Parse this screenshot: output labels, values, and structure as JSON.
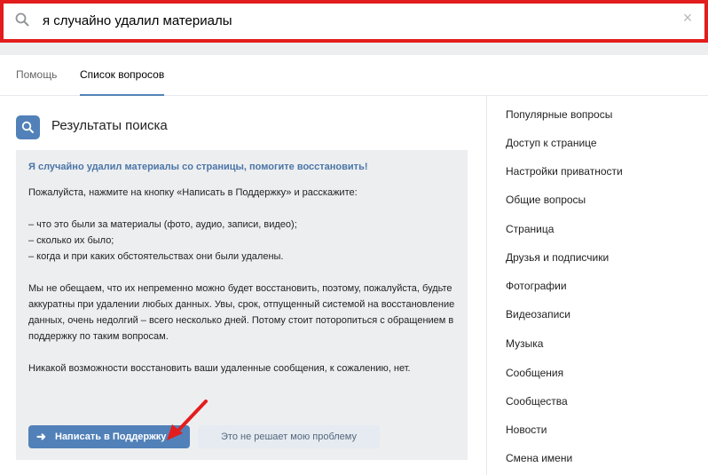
{
  "search": {
    "value": "я случайно удалил материалы",
    "icon": "search-icon",
    "clear_glyph": "×"
  },
  "tabs": [
    {
      "label": "Помощь",
      "active": false
    },
    {
      "label": "Список вопросов",
      "active": true
    }
  ],
  "results": {
    "title": "Результаты поиска",
    "question": "Я случайно удалил материалы со страницы, помогите восстановить!",
    "paragraphs": [
      "Пожалуйста, нажмите на кнопку «Написать в Поддержку» и расскажите:",
      "– что это были за материалы (фото, аудио, записи, видео);\n– сколько их было;\n– когда и при каких обстоятельствах они были удалены.",
      "Мы не обещаем, что их непременно можно будет восстановить, поэтому, пожалуйста, будьте аккуратны при удалении любых данных. Увы, срок, отпущенный системой на восстановление данных, очень недолгий – всего несколько дней. Потому стоит поторопиться с обращением в поддержку по таким вопросам.",
      "Никакой возможности восстановить ваши удаленные сообщения, к сожалению, нет."
    ],
    "primary_button": "Написать в Поддержку",
    "primary_arrow": "➜",
    "secondary_button": "Это не решает мою проблему"
  },
  "sidebar": {
    "items": [
      "Популярные вопросы",
      "Доступ к странице",
      "Настройки приватности",
      "Общие вопросы",
      "Страница",
      "Друзья и подписчики",
      "Фотографии",
      "Видеозаписи",
      "Музыка",
      "Сообщения",
      "Сообщества",
      "Новости",
      "Смена имени"
    ]
  },
  "colors": {
    "highlight_border": "#e31d1d",
    "accent": "#5181b8",
    "link": "#4a76a8",
    "card_bg": "#edeef0"
  }
}
